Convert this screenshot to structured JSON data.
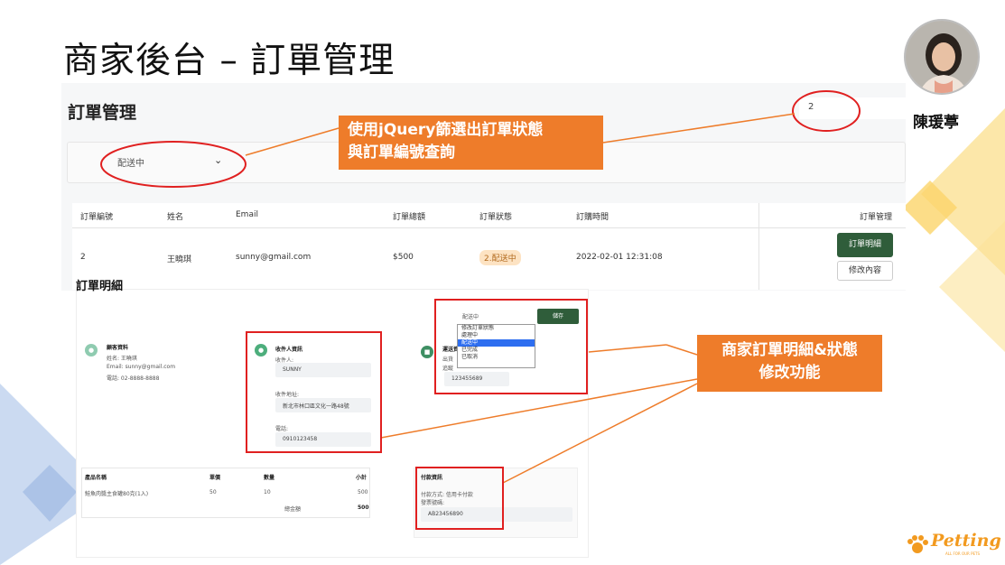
{
  "slide": {
    "title": "商家後台 – 訂單管理",
    "presenter_name": "陳瑗葶"
  },
  "admin": {
    "title": "訂單管理",
    "search_value": "2",
    "filter_selected": "配送中",
    "table": {
      "headers": [
        "訂單編號",
        "姓名",
        "Email",
        "訂單總額",
        "訂單狀態",
        "訂購時間",
        "訂單管理"
      ],
      "row": {
        "id": "2",
        "name": "王曉琪",
        "email": "sunny@gmail.com",
        "total": "$500",
        "status": "2.配送中",
        "time": "2022-02-01 12:31:08"
      },
      "detail_button": "訂單明細",
      "edit_button": "修改內容"
    }
  },
  "detail": {
    "heading": "訂單明細",
    "customer": {
      "title": "顧客資料",
      "name": "姓名: 王曉琪",
      "email": "Email: sunny@gmail.com",
      "phone": "電話: 02-8888-8888"
    },
    "recipient": {
      "title": "收件人資訊",
      "name_label": "收件人:",
      "name_value": "SUNNY",
      "address_label": "收件地址:",
      "address_value": "新北市林口區文化一路48號",
      "phone_label": "電話:",
      "phone_value": "0910123458"
    },
    "shipping": {
      "title": "運送資",
      "line1": "出貨",
      "line2": "追蹤",
      "tracking_value": "123455689"
    },
    "status_select": {
      "current": "配送中",
      "save_button": "儲存",
      "options": [
        "修改訂單狀態",
        "處理中",
        "配送中",
        "已完成",
        "已取消"
      ],
      "selected_index": 2
    },
    "products": {
      "headers": [
        "產品名稱",
        "單價",
        "數量",
        "小計"
      ],
      "rows": [
        {
          "name": "鮭魚肉醬主食罐80克(1入)",
          "price": "50",
          "qty": "10",
          "subtotal": "500"
        }
      ],
      "total_label": "總金額",
      "total_value": "500"
    },
    "payment": {
      "title": "付款資訊",
      "method": "付款方式: 信用卡付款",
      "invoice_label": "發票號碼:",
      "invoice_value": "AB23456890"
    }
  },
  "callouts": {
    "jquery_filter": [
      "使用jQuery篩選出訂單狀態",
      "與訂單編號查詢"
    ],
    "detail_edit": [
      "商家訂單明細&狀態",
      "修改功能"
    ]
  },
  "logo": {
    "text": "Petting",
    "tagline": "ALL FOR OUR PETS"
  },
  "colors": {
    "callout": "#ee7c2a",
    "highlight": "#e02020",
    "primary_button": "#2f5d3a",
    "deco_yellow": "#fbe39a",
    "deco_blue": "#c5d6ef"
  }
}
